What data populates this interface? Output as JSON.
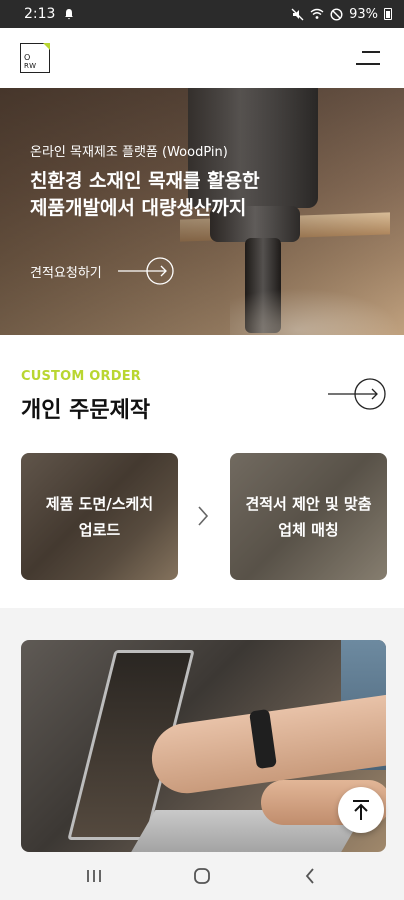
{
  "status_bar": {
    "time": "2:13",
    "battery": "93%"
  },
  "header": {
    "logo_line1": "O",
    "logo_line2": "RW"
  },
  "hero": {
    "subtitle": "온라인 목재제조 플랫폼 (WoodPin)",
    "title_line1": "친환경 소재인 목재를 활용한",
    "title_line2": "제품개발에서 대량생산까지",
    "cta_label": "견적요청하기"
  },
  "custom_order": {
    "eyebrow": "CUSTOM ORDER",
    "title": "개인 주문제작",
    "step1_line1": "제품 도면/스케치",
    "step1_line2": "업로드",
    "step2_line1": "견적서 제안 및 맞춤",
    "step2_line2": "업체 매칭"
  },
  "colors": {
    "accent": "#b9d631",
    "status_bar": "#2b2b2b",
    "section_gray": "#f3f3f3"
  },
  "icons": [
    "hamburger-menu-icon",
    "arrow-right-circle-icon",
    "chevron-right-icon",
    "arrow-up-to-top-icon",
    "recent-apps-icon",
    "home-icon",
    "back-icon"
  ]
}
